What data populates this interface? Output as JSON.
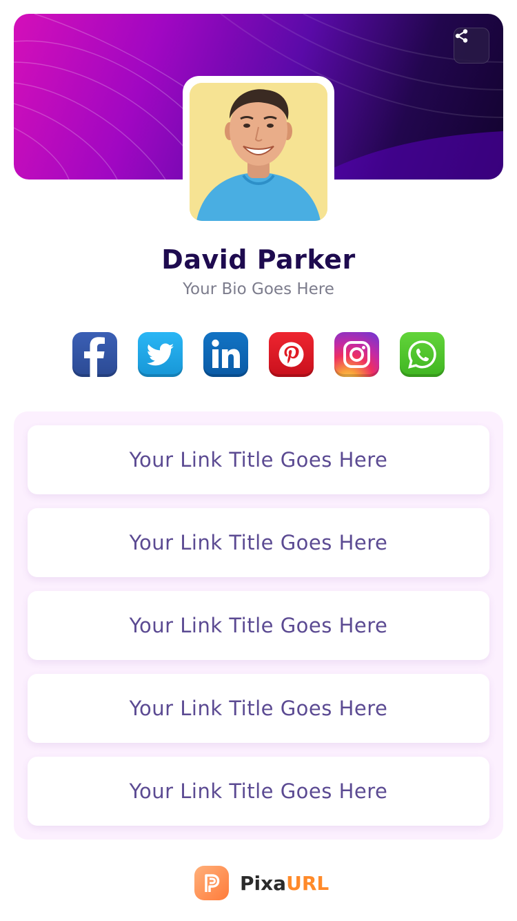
{
  "profile": {
    "name": "David Parker",
    "bio": "Your Bio Goes Here"
  },
  "header": {
    "share_icon": "share-icon"
  },
  "socials": [
    {
      "name": "facebook",
      "color": "#2d4f9e"
    },
    {
      "name": "twitter",
      "color": "#1da1f2"
    },
    {
      "name": "linkedin",
      "color": "#0a66c2"
    },
    {
      "name": "pinterest",
      "color": "#e60023"
    },
    {
      "name": "instagram",
      "color": "#c13584"
    },
    {
      "name": "whatsapp",
      "color": "#4ec72b"
    }
  ],
  "links": [
    {
      "label": "Your Link Title Goes Here"
    },
    {
      "label": "Your Link Title Goes Here"
    },
    {
      "label": "Your Link Title Goes Here"
    },
    {
      "label": "Your Link Title Goes Here"
    },
    {
      "label": "Your Link Title Goes Here"
    }
  ],
  "footer": {
    "brand_part1": "Pixa",
    "brand_part2": "URL",
    "brand_color": "#ff8a2a"
  }
}
